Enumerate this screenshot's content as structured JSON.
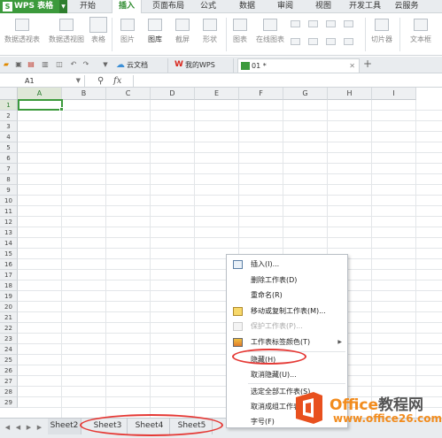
{
  "app": {
    "name": "WPS 表格",
    "logo": "S"
  },
  "menu_tabs": [
    "开始",
    "插入",
    "页面布局",
    "公式",
    "数据",
    "审阅",
    "视图",
    "开发工具",
    "云服务"
  ],
  "active_menu_tab": "插入",
  "ribbon": {
    "pivot_table": "数据透视表",
    "pivot_chart": "数据透视图",
    "table": "表格",
    "picture": "图片",
    "gallery": "图库",
    "screenshot": "截屏",
    "shapes": "形状",
    "chart": "图表",
    "online_chart": "在线图表",
    "slicer": "切片器",
    "textbox": "文本框"
  },
  "doc_tabs": [
    {
      "label": "云文档"
    },
    {
      "label": "我的WPS"
    },
    {
      "label": "01 *"
    }
  ],
  "formula_bar": {
    "cell_ref": "A1",
    "fx": "fx",
    "value": ""
  },
  "columns": [
    "A",
    "B",
    "C",
    "D",
    "E",
    "F",
    "G",
    "H",
    "I"
  ],
  "rows": [
    "1",
    "2",
    "3",
    "4",
    "5",
    "6",
    "7",
    "8",
    "9",
    "10",
    "11",
    "12",
    "13",
    "14",
    "15",
    "16",
    "17",
    "18",
    "19",
    "20",
    "21",
    "22",
    "23",
    "24",
    "25",
    "26",
    "27",
    "28",
    "29"
  ],
  "selected_cell": "A1",
  "sheets": [
    "Sheet2",
    "Sheet3",
    "Sheet4",
    "Sheet5"
  ],
  "context_menu": {
    "items": [
      {
        "label": "插入(I)...",
        "icon": "insert-sheet-icon",
        "enabled": true
      },
      {
        "label": "删除工作表(D)",
        "enabled": true
      },
      {
        "label": "重命名(R)",
        "enabled": true
      },
      {
        "label": "移动或复制工作表(M)...",
        "icon": "move-copy-icon",
        "enabled": true
      },
      {
        "label": "保护工作表(P)...",
        "icon": "protect-sheet-icon",
        "enabled": false
      },
      {
        "label": "工作表标签颜色(T)",
        "icon": "tab-color-icon",
        "enabled": true,
        "submenu": true
      },
      {
        "label": "隐藏(H)",
        "enabled": true
      },
      {
        "label": "取消隐藏(U)...",
        "enabled": true
      },
      {
        "label": "选定全部工作表(S)",
        "enabled": true
      },
      {
        "label": "取消成组工作表",
        "enabled": true
      },
      {
        "label": "字号(F)",
        "enabled": true
      }
    ]
  },
  "watermark": {
    "brand_prefix": "Office",
    "brand_suffix": "教程网",
    "site": "www.office26.com"
  },
  "colors": {
    "accent": "#3c9a3c",
    "annotation": "#e53935",
    "watermark": "#f28c1e"
  }
}
